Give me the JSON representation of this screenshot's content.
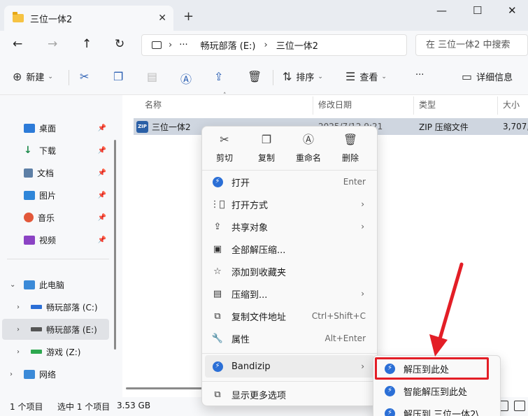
{
  "window": {
    "tab_title": "三位一体2",
    "close_tab": "✕",
    "new_tab": "+",
    "minimize": "—",
    "maximize": "☐",
    "close": "✕"
  },
  "nav": {
    "back": "←",
    "forward": "→",
    "up": "↑",
    "refresh": "↻",
    "breadcrumb_more": "···",
    "breadcrumb_sep": "›",
    "crumb1": "畅玩部落 (E:)",
    "crumb2": "三位一体2",
    "search_placeholder": "在 三位一体2 中搜索"
  },
  "toolbar": {
    "new_label": "新建",
    "sort_label": "排序",
    "view_label": "查看",
    "more": "···",
    "details_label": "详细信息",
    "caret": "⌄"
  },
  "sidebar": {
    "items": [
      {
        "label": "桌面",
        "color": "#2d7bd8"
      },
      {
        "label": "下载",
        "color": "#1f8a4c"
      },
      {
        "label": "文档",
        "color": "#5d7fa6"
      },
      {
        "label": "图片",
        "color": "#2f86d9"
      },
      {
        "label": "音乐",
        "color": "#e2583a"
      },
      {
        "label": "视频",
        "color": "#8b43c4"
      }
    ],
    "this_pc": "此电脑",
    "drives": [
      "畅玩部落 (C:)",
      "畅玩部落 (E:)",
      "游戏 (Z:)"
    ],
    "network": "网络",
    "pin_glyph": "📌"
  },
  "columns": {
    "name": "名称",
    "date": "修改日期",
    "type": "类型",
    "size": "大小"
  },
  "file": {
    "name": "三位一体2",
    "date": "2025/7/12 9:21",
    "type": "ZIP 压缩文件",
    "size": "3,707,"
  },
  "status": {
    "count": "1 个项目",
    "selected": "选中 1 个项目",
    "selected_size": "3.53 GB"
  },
  "context_menu": {
    "quick": [
      {
        "label": "剪切",
        "icon": "cut-icon"
      },
      {
        "label": "复制",
        "icon": "copy-icon"
      },
      {
        "label": "重命名",
        "icon": "rename-icon"
      },
      {
        "label": "删除",
        "icon": "delete-icon"
      }
    ],
    "items": [
      {
        "label": "打开",
        "shortcut": "Enter"
      },
      {
        "label": "打开方式",
        "shortcut": ""
      },
      {
        "label": "共享对象",
        "shortcut": ""
      },
      {
        "label": "全部解压缩...",
        "shortcut": ""
      },
      {
        "label": "添加到收藏夹",
        "shortcut": ""
      },
      {
        "label": "压缩到...",
        "shortcut": ""
      },
      {
        "label": "复制文件地址",
        "shortcut": "Ctrl+Shift+C"
      },
      {
        "label": "属性",
        "shortcut": "Alt+Enter"
      },
      {
        "label": "Bandizip",
        "shortcut": ""
      },
      {
        "label": "显示更多选项",
        "shortcut": ""
      }
    ]
  },
  "submenu": {
    "items": [
      "解压到此处",
      "智能解压到此处",
      "解压到 三位一体2\\"
    ]
  },
  "accent": {
    "highlight_red": "#e31e26",
    "bandizip_blue": "#2b6fd6"
  }
}
